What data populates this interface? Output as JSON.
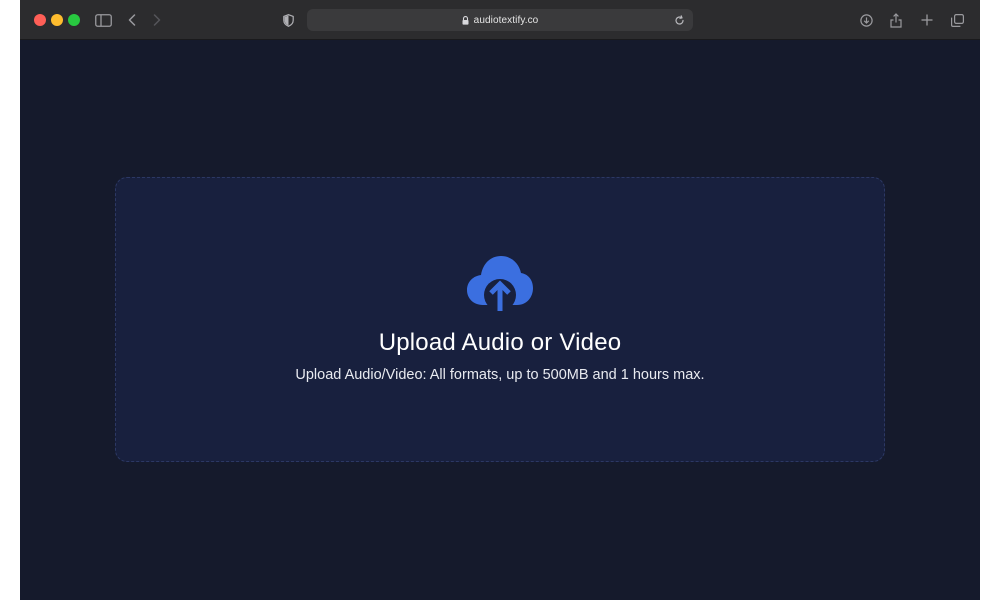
{
  "browser": {
    "url": "audiotextify.co",
    "icons": {
      "close": "close-dot",
      "minimize": "minimize-dot",
      "zoom": "zoom-dot",
      "sidebar": "sidebar-icon",
      "back": "back-arrow-icon",
      "forward": "forward-arrow-icon",
      "privacy": "privacy-shield-icon",
      "lock": "lock-icon",
      "reload": "reload-icon",
      "downloads": "download-icon",
      "share": "share-icon",
      "new_tab": "plus-icon",
      "tabs": "tab-overview-icon"
    },
    "colors": {
      "close": "#ff5f57",
      "minimize": "#febc2e",
      "zoom": "#28c840"
    }
  },
  "page": {
    "background": "#151a2c",
    "dropzone": {
      "title": "Upload Audio or Video",
      "subtitle": "Upload Audio/Video: All formats, up to 500MB and 1 hours max.",
      "icon": "cloud-upload-icon",
      "accent": "#3b6fe0"
    }
  }
}
